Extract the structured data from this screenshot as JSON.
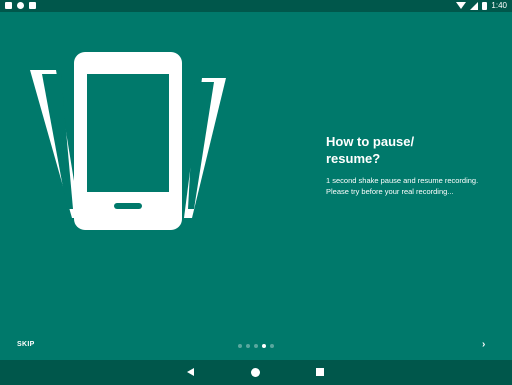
{
  "status_bar": {
    "time": "1:40",
    "icons": [
      "notification-icon",
      "sync-icon",
      "sd-card-icon",
      "wifi-icon",
      "signal-icon",
      "battery-icon"
    ]
  },
  "slide": {
    "title": "How to pause/\nresume?",
    "description": "1 second shake pause and resume recording. Please try before your real recording...",
    "illustration": "shaking-phone-icon"
  },
  "footer": {
    "skip_label": "SKIP",
    "next_icon": "›",
    "pages_total": 4,
    "page_active": 3
  },
  "colors": {
    "background": "#00796B",
    "bars": "#00574B",
    "foreground": "#FFFFFF"
  }
}
